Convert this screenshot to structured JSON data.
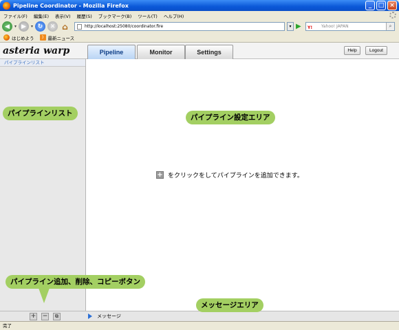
{
  "window": {
    "title": "Pipeline Coordinator - Mozilla Firefox"
  },
  "menu": [
    "ファイル(F)",
    "編集(E)",
    "表示(V)",
    "履歴(S)",
    "ブックマーク(B)",
    "ツール(T)",
    "ヘルプ(H)"
  ],
  "nav": {
    "url": "http://localhost:25080/coordinator.fire",
    "search_placeholder": "Yahoo! JAPAN",
    "search_engine": "Y!"
  },
  "bookmarks": [
    "はじめよう",
    "最新ニュース"
  ],
  "app": {
    "logo": "asteria warp",
    "tabs": [
      "Pipeline",
      "Monitor",
      "Settings"
    ],
    "help": "Help",
    "logout": "Logout"
  },
  "sidebar": {
    "header": "パイプラインリスト"
  },
  "main": {
    "hint": "をクリックをしてパイプラインを追加できます。"
  },
  "bottom": {
    "message_label": "メッセージ"
  },
  "status": "完了",
  "callouts": {
    "list": "パイプラインリスト",
    "settings": "パイプライン設定エリア",
    "buttons": "パイプライン追加、削除、コピーボタン",
    "message": "メッセージエリア"
  }
}
